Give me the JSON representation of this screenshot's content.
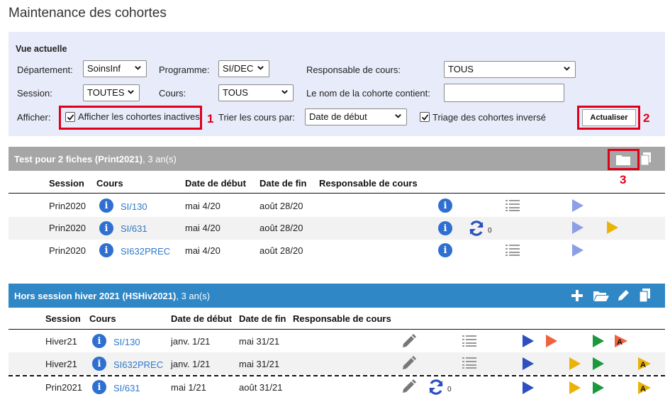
{
  "page": {
    "title": "Maintenance des cohortes"
  },
  "filters": {
    "heading": "Vue actuelle",
    "departement": {
      "label": "Département:",
      "value": "SoinsInf"
    },
    "programme": {
      "label": "Programme:",
      "value": "SI/DEC"
    },
    "responsable": {
      "label": "Responsable de cours:",
      "value": "TOUS"
    },
    "session": {
      "label": "Session:",
      "value": "TOUTES"
    },
    "cours": {
      "label": "Cours:",
      "value": "TOUS"
    },
    "nom_cohorte": {
      "label": "Le nom de la cohorte contient:",
      "value": ""
    },
    "afficher": {
      "label": "Afficher:",
      "inactives_label": "Afficher les cohortes inactives",
      "inactives_checked": true
    },
    "trier": {
      "label": "Trier les cours par:",
      "value": "Date de début"
    },
    "inverse": {
      "label": "Triage des cohortes inversé",
      "checked": true
    },
    "actualiser_label": "Actualiser"
  },
  "annotations": {
    "n1": "1",
    "n2": "2",
    "n3": "3"
  },
  "cohort1": {
    "name": "Test pour 2 fiches (Print2021)",
    "duration": ", 3 an(s)",
    "columns": {
      "session": "Session",
      "cours": "Cours",
      "debut": "Date de début",
      "fin": "Date de fin",
      "resp": "Responsable de cours"
    },
    "rows": [
      {
        "session": "Prin2020",
        "cours": "SI/130",
        "debut": "mai 4/20",
        "fin": "août 28/20"
      },
      {
        "session": "Prin2020",
        "cours": "SI/631",
        "debut": "mai 4/20",
        "fin": "août 28/20",
        "sync_count": "0"
      },
      {
        "session": "Prin2020",
        "cours": "SI632PREC",
        "debut": "mai 4/20",
        "fin": "août 28/20"
      }
    ]
  },
  "cohort2": {
    "name": "Hors session hiver 2021 (HSHiv2021)",
    "duration": ", 3 an(s)",
    "columns": {
      "session": "Session",
      "cours": "Cours",
      "debut": "Date de début",
      "fin": "Date de fin",
      "resp": "Responsable de cours"
    },
    "rows": [
      {
        "session": "Hiver21",
        "cours": "SI/130",
        "debut": "janv. 1/21",
        "fin": "mai 31/21"
      },
      {
        "session": "Hiver21",
        "cours": "SI632PREC",
        "debut": "janv. 1/21",
        "fin": "mai 31/21"
      },
      {
        "session": "Prin2021",
        "cours": "SI/631",
        "debut": "mai 1/21",
        "fin": "août 31/21",
        "sync_count": "0"
      }
    ]
  },
  "icons": {
    "info": "i",
    "a_letter": "A",
    "colors": {
      "blue_play": "#2d4fbf",
      "light_play": "#8c9ee6",
      "orange": "#f0623f",
      "green": "#1a9a3c",
      "yellow": "#eab308",
      "info": "#2e6fd1"
    }
  }
}
